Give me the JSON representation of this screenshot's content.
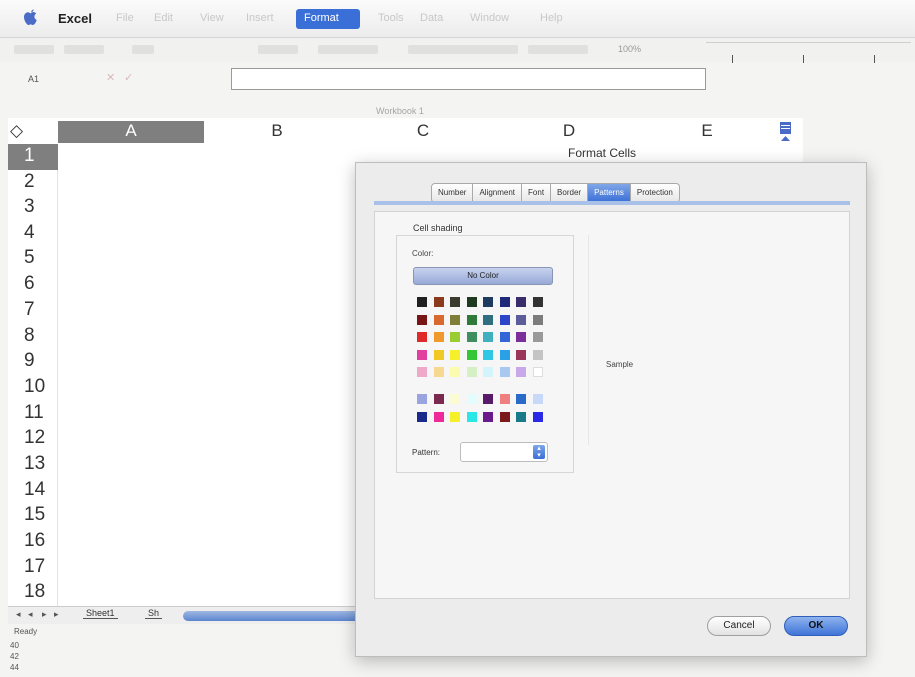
{
  "menubar": {
    "app_name": "Excel",
    "items": [
      "File",
      "Edit",
      "View",
      "Insert",
      "Format",
      "Tools",
      "Data",
      "Window",
      "Help"
    ],
    "active_item": "Format"
  },
  "toolbar": {
    "zoom": "100%"
  },
  "formula_bar": {
    "cell_ref": "A1",
    "cancel_glyph": "✕",
    "confirm_glyph": "✓",
    "content": ""
  },
  "workbook_title": "Workbook 1",
  "sheet": {
    "columns": [
      "A",
      "B",
      "C",
      "D",
      "E"
    ],
    "selected_column": "A",
    "rows": [
      "1",
      "2",
      "3",
      "4",
      "5",
      "6",
      "7",
      "8",
      "9",
      "10",
      "11",
      "12",
      "13",
      "14",
      "15",
      "16",
      "17",
      "18"
    ],
    "selected_row": "1",
    "tabs": [
      "Sheet1",
      "Sh"
    ],
    "status": "Ready",
    "margin_numbers": [
      "40",
      "42",
      "44"
    ]
  },
  "dialog": {
    "title": "Format Cells",
    "tabs": [
      "Number",
      "Alignment",
      "Font",
      "Border",
      "Patterns",
      "Protection"
    ],
    "active_tab": "Patterns",
    "shading_legend": "Cell shading",
    "color_label": "Color:",
    "no_color_label": "No Color",
    "pattern_label": "Pattern:",
    "pattern_value": "",
    "sample_label": "Sample",
    "cancel_label": "Cancel",
    "ok_label": "OK",
    "palette_main": [
      [
        "#202020",
        "#8b3a1d",
        "#3b3b2e",
        "#203a20",
        "#1f3a5f",
        "#1f2a7a",
        "#3a2d6e",
        "#333333"
      ],
      [
        "#7a1515",
        "#d9692e",
        "#7f7f3a",
        "#2f7a3a",
        "#2f6f7f",
        "#2c45c9",
        "#5c5c9a",
        "#7c7c7c"
      ],
      [
        "#e02a2a",
        "#f09a2e",
        "#9acd32",
        "#3f8f5e",
        "#40b0c0",
        "#3466d8",
        "#7a2f9a",
        "#9a9a9a"
      ],
      [
        "#e23ea0",
        "#f2c824",
        "#f5f02a",
        "#34c634",
        "#2ec8e6",
        "#2aa0e6",
        "#9a3458",
        "#c4c4c4"
      ],
      [
        "#f0a8c8",
        "#f6d890",
        "#fcfcb0",
        "#d4f0c4",
        "#d4f4fc",
        "#a8c8f0",
        "#c8a8e8",
        "#ffffff"
      ]
    ],
    "palette_chart": [
      [
        "#9aa4e0",
        "#7a2a4f",
        "#fcfcd4",
        "#e4fcfc",
        "#5a1a6a",
        "#f08080",
        "#2a6ac8",
        "#c8d8f8"
      ],
      [
        "#1a2a8a",
        "#ee2a9a",
        "#f5f02a",
        "#2ae6e6",
        "#6a1a8a",
        "#7a1a1a",
        "#1a7a8a",
        "#2a2ae6"
      ]
    ]
  }
}
